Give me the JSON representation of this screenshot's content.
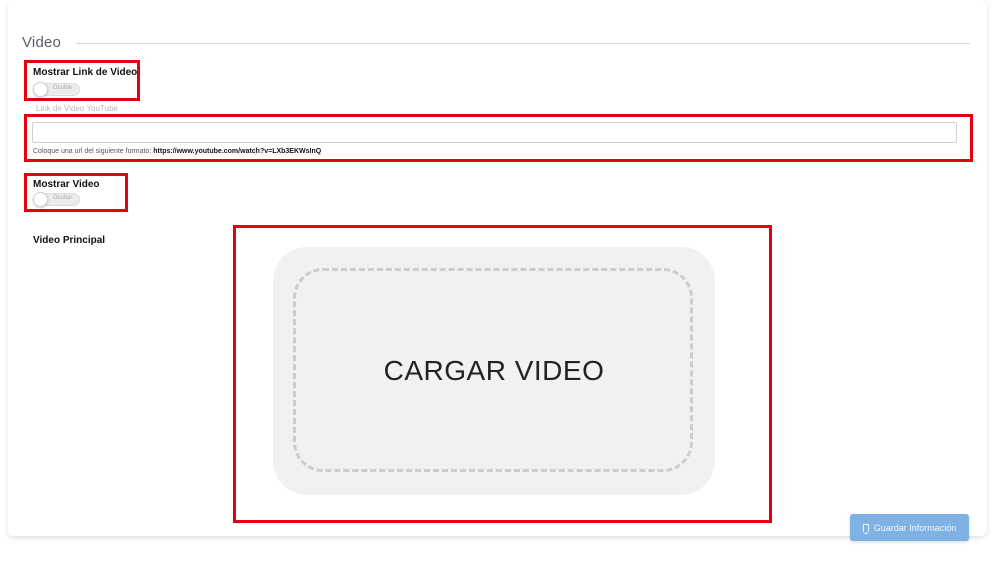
{
  "section": {
    "title": "Video"
  },
  "link_toggle": {
    "label": "Mostrar Link de Video",
    "state_text": "Ocultar"
  },
  "youtube": {
    "float_label": "Link de Video YouTube",
    "value": "",
    "hint_prefix": "Coloque una url del siguiente formato: ",
    "hint_example": "https://www.youtube.com/watch?v=LXb3EKWsInQ"
  },
  "video_toggle": {
    "label": "Mostrar Video",
    "state_text": "Ocultar"
  },
  "main_video": {
    "label": "Video Principal",
    "upload_text": "CARGAR VIDEO"
  },
  "actions": {
    "save_label": "Guardar Información"
  },
  "colors": {
    "highlight": "#e3000f",
    "save_button": "#7fb1e4",
    "upload_bg": "#f1f1f1"
  }
}
